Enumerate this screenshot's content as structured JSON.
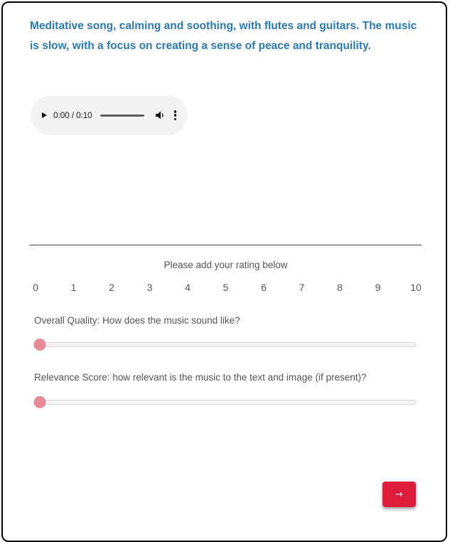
{
  "prompt": {
    "text": "Meditative song, calming and soothing, with flutes and guitars. The music is slow, with a focus on creating a sense of peace and tranquility."
  },
  "audio_player": {
    "time_display": "0:00 / 0:10",
    "play_icon": "play-icon",
    "volume_icon": "volume-icon",
    "more_icon": "more-vertical-icon"
  },
  "rating": {
    "title": "Please add your rating below",
    "scale": [
      "0",
      "1",
      "2",
      "3",
      "4",
      "5",
      "6",
      "7",
      "8",
      "9",
      "10"
    ],
    "questions": [
      {
        "label": "Overall Quality: How does the music sound like?",
        "value": 0,
        "min": 0,
        "max": 10
      },
      {
        "label": "Relevance Score: how relevant is the music to the text and image (if present)?",
        "value": 0,
        "min": 0,
        "max": 10
      }
    ]
  },
  "next_button": {
    "label": "→",
    "color": "#dc1c3c"
  },
  "colors": {
    "prompt_text": "#2a7ab8",
    "slider_thumb": "#e88a96"
  }
}
